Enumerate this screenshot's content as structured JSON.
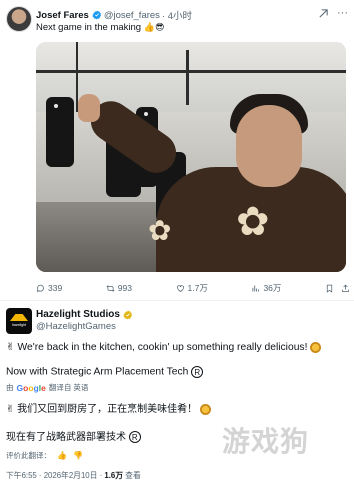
{
  "tweet1": {
    "author_name": "Josef Fares",
    "handle": "@josef_fares",
    "time": "· 4小时",
    "text": "Next game in the making",
    "emojis": [
      "👍",
      "😎"
    ],
    "stats": {
      "replies": "339",
      "reposts": "993",
      "likes": "1.7万",
      "views": "36万"
    }
  },
  "tweet2": {
    "author_name": "Hazelight Studios",
    "handle": "@HazelightGames",
    "avatar_text": "hazelight",
    "line1": "We're back in the kitchen, cookin' up something really delicious!",
    "line2": "Now with Strategic Arm Placement Tech",
    "reg_symbol": "R",
    "translated_by": "由",
    "translated_suffix": "翻译自 英语",
    "translation_line1": "我们又回到厨房了，正在烹制美味佳肴！",
    "translation_line2": "现在有了战略武器部署技术",
    "rate_translation": "评价此翻译：",
    "meta_time": "下午6:55 · 2026年2月10日 · ",
    "meta_views": "1.6万",
    "meta_views_suffix": " 查看"
  },
  "watermark": "游戏狗",
  "colors": {
    "verified_blue": "#1d9bf0",
    "verified_gold": "#e2b719",
    "text_primary": "#0f1419",
    "text_secondary": "#536471"
  },
  "icons": {
    "more": "more-icon",
    "grok": "grok-icon",
    "reply": "reply-icon",
    "repost": "repost-icon",
    "like": "heart-icon",
    "views": "views-icon",
    "bookmark": "bookmark-icon",
    "share": "share-icon"
  }
}
